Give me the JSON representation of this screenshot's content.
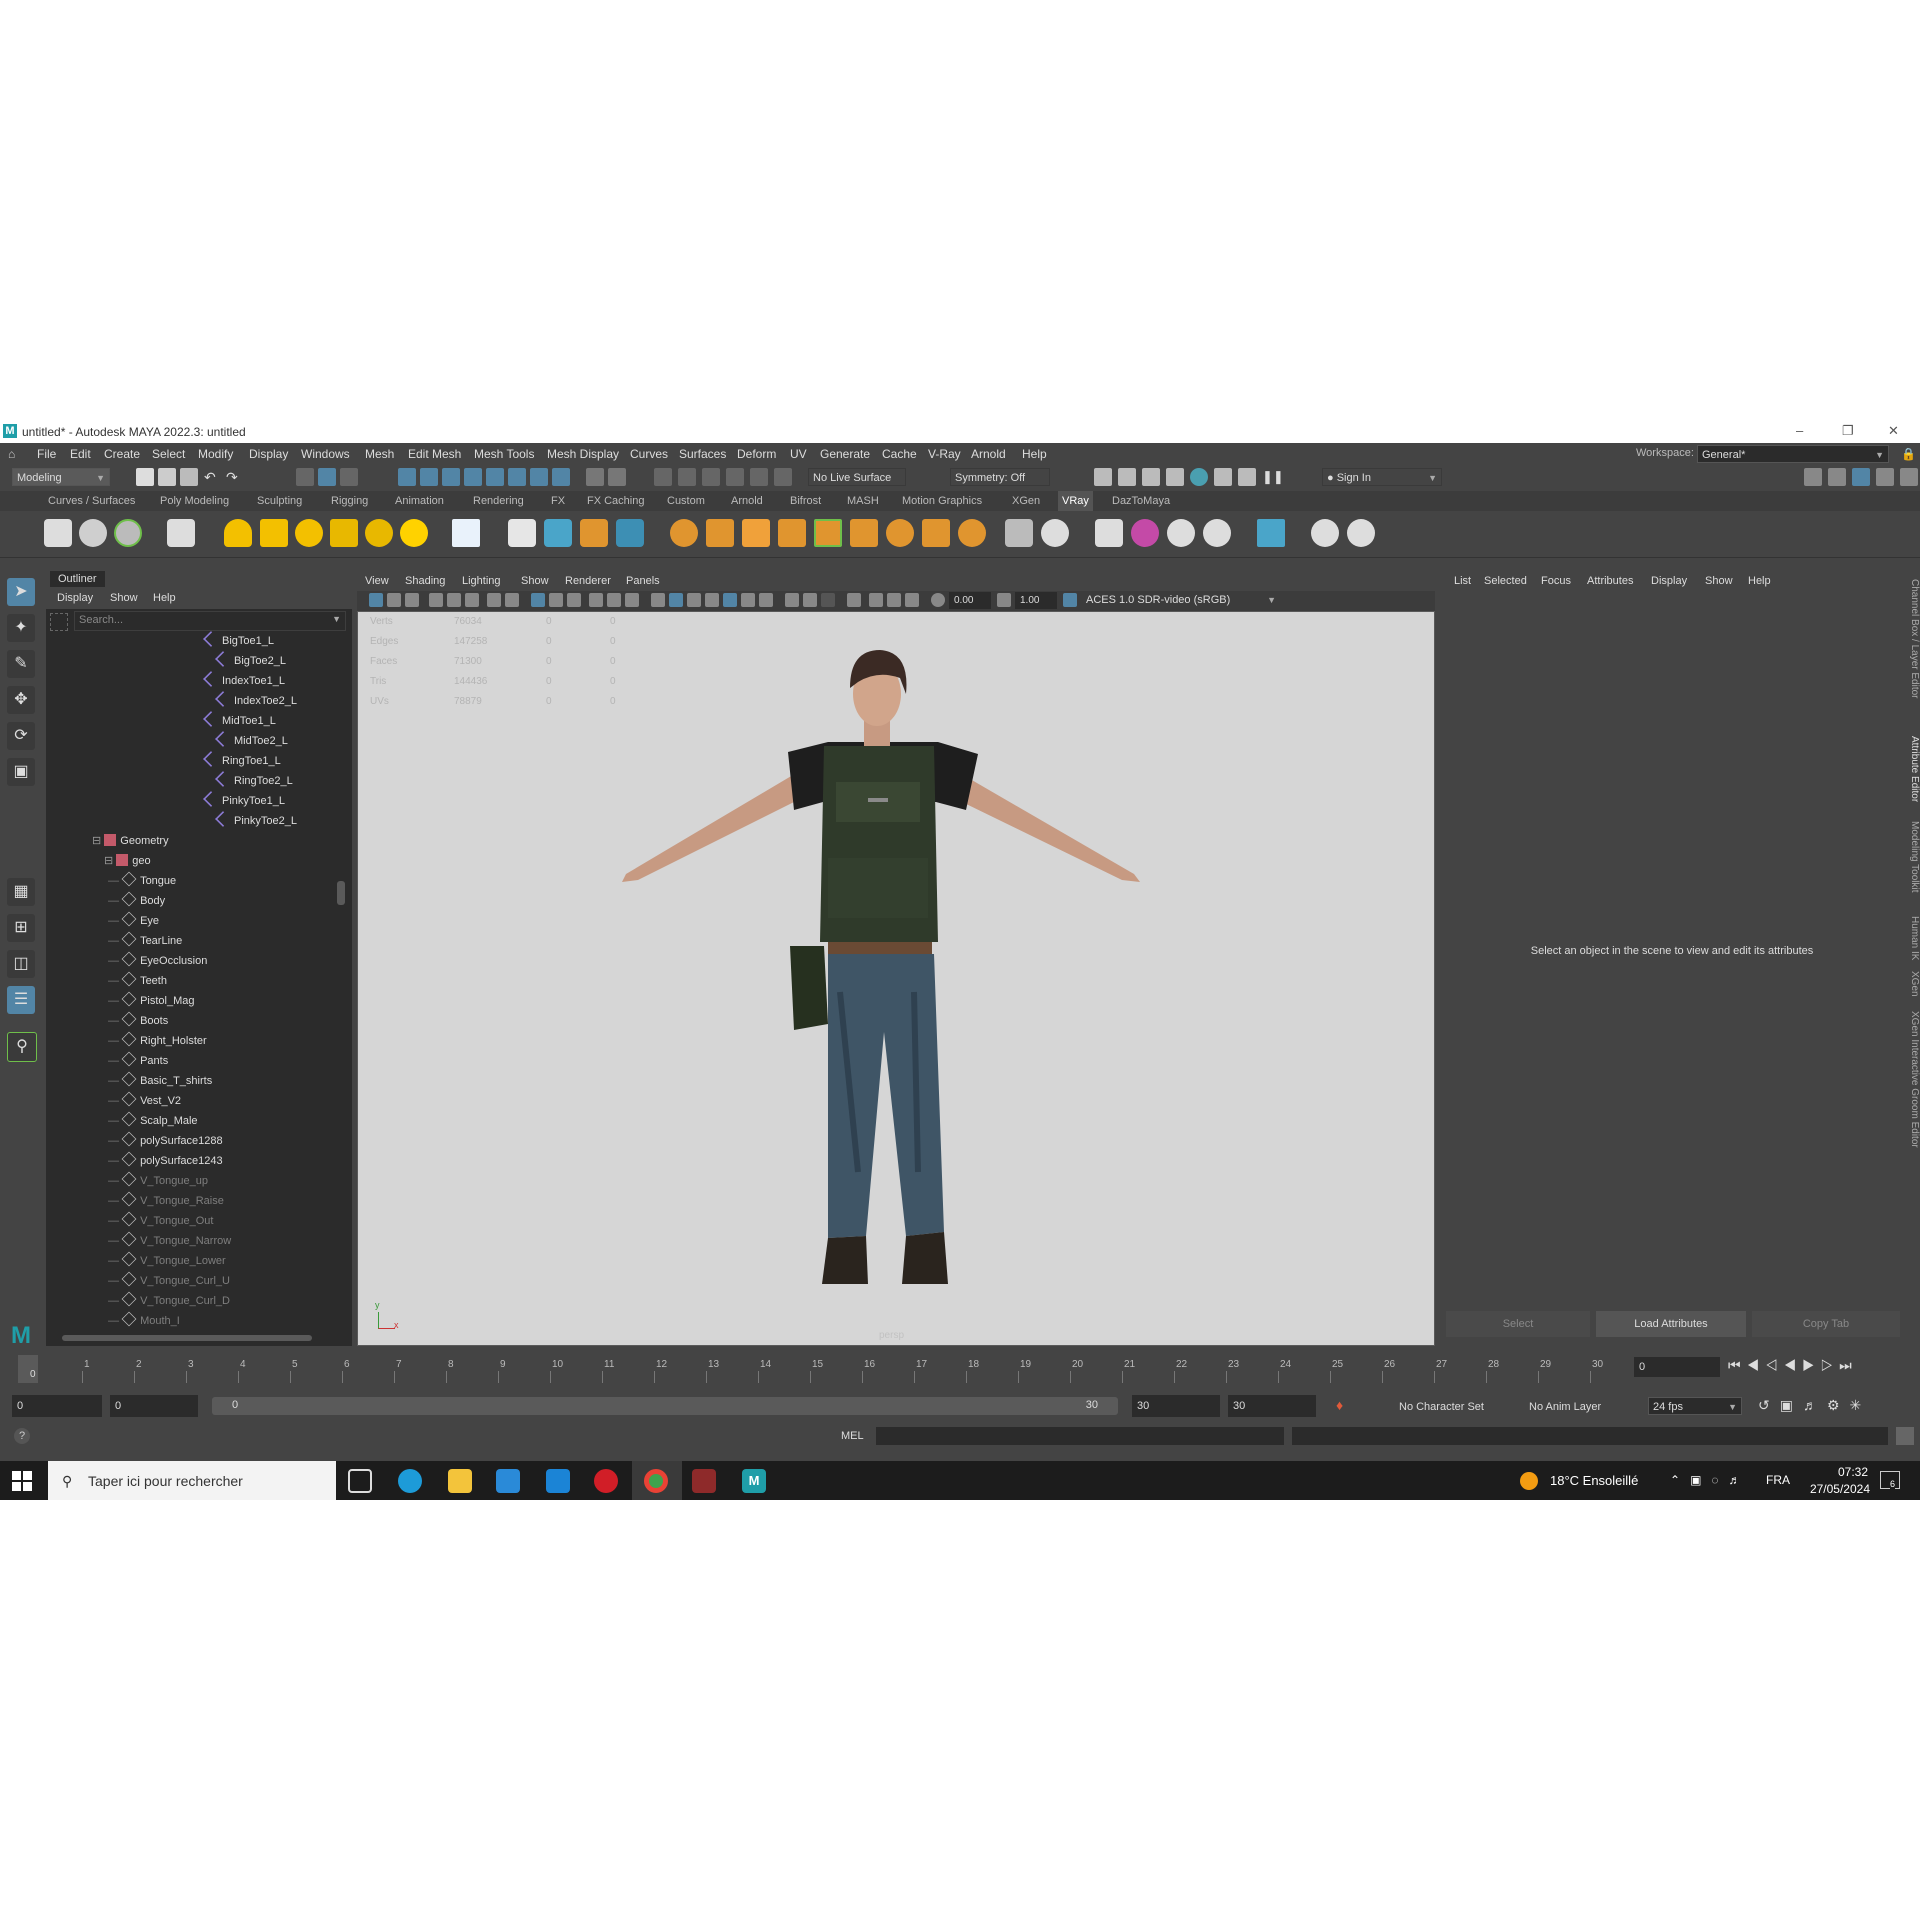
{
  "window": {
    "title": "untitled* - Autodesk MAYA 2022.3: untitled",
    "logo": "M"
  },
  "menubar": {
    "items": [
      "File",
      "Edit",
      "Create",
      "Select",
      "Modify",
      "Display",
      "Windows",
      "Mesh",
      "Edit Mesh",
      "Mesh Tools",
      "Mesh Display",
      "Curves",
      "Surfaces",
      "Deform",
      "UV",
      "Generate",
      "Cache",
      "V-Ray",
      "Arnold",
      "Help"
    ],
    "workspace_label": "Workspace:",
    "workspace_value": "General*"
  },
  "statusline": {
    "mode": "Modeling",
    "live_surface": "No Live Surface",
    "symmetry": "Symmetry: Off",
    "sign_in": "Sign In"
  },
  "shelf": {
    "tabs": [
      "Curves / Surfaces",
      "Poly Modeling",
      "Sculpting",
      "Rigging",
      "Animation",
      "Rendering",
      "FX",
      "FX Caching",
      "Custom",
      "Arnold",
      "Bifrost",
      "MASH",
      "Motion Graphics",
      "XGen",
      "VRay",
      "DazToMaya"
    ],
    "active_tab": "VRay"
  },
  "outliner": {
    "tab": "Outliner",
    "menu": [
      "Display",
      "Show",
      "Help"
    ],
    "search_placeholder": "Search...",
    "joints": [
      {
        "label": "BigToe1_L",
        "level": 0
      },
      {
        "label": "BigToe2_L",
        "level": 1
      },
      {
        "label": "IndexToe1_L",
        "level": 0
      },
      {
        "label": "IndexToe2_L",
        "level": 1
      },
      {
        "label": "MidToe1_L",
        "level": 0
      },
      {
        "label": "MidToe2_L",
        "level": 1
      },
      {
        "label": "RingToe1_L",
        "level": 0
      },
      {
        "label": "RingToe2_L",
        "level": 1
      },
      {
        "label": "PinkyToe1_L",
        "level": 0
      },
      {
        "label": "PinkyToe2_L",
        "level": 1
      }
    ],
    "geometry_group": "Geometry",
    "geo_group": "geo",
    "meshes": [
      {
        "label": "Tongue",
        "dim": false
      },
      {
        "label": "Body",
        "dim": false
      },
      {
        "label": "Eye",
        "dim": false
      },
      {
        "label": "TearLine",
        "dim": false
      },
      {
        "label": "EyeOcclusion",
        "dim": false
      },
      {
        "label": "Teeth",
        "dim": false
      },
      {
        "label": "Pistol_Mag",
        "dim": false
      },
      {
        "label": "Boots",
        "dim": false
      },
      {
        "label": "Right_Holster",
        "dim": false
      },
      {
        "label": "Pants",
        "dim": false
      },
      {
        "label": "Basic_T_shirts",
        "dim": false
      },
      {
        "label": "Vest_V2",
        "dim": false
      },
      {
        "label": "Scalp_Male",
        "dim": false
      },
      {
        "label": "polySurface1288",
        "dim": false
      },
      {
        "label": "polySurface1243",
        "dim": false
      },
      {
        "label": "V_Tongue_up",
        "dim": true
      },
      {
        "label": "V_Tongue_Raise",
        "dim": true
      },
      {
        "label": "V_Tongue_Out",
        "dim": true
      },
      {
        "label": "V_Tongue_Narrow",
        "dim": true
      },
      {
        "label": "V_Tongue_Lower",
        "dim": true
      },
      {
        "label": "V_Tongue_Curl_U",
        "dim": true
      },
      {
        "label": "V_Tongue_Curl_D",
        "dim": true
      },
      {
        "label": "Mouth_I",
        "dim": true
      }
    ]
  },
  "viewport": {
    "menu": [
      "View",
      "Shading",
      "Lighting",
      "Show",
      "Renderer",
      "Panels"
    ],
    "exposure": "0.00",
    "gamma": "1.00",
    "color_space": "ACES 1.0 SDR-video (sRGB)",
    "hud": [
      {
        "label": "Verts",
        "value": "76034",
        "a": "0",
        "b": "0"
      },
      {
        "label": "Edges",
        "value": "147258",
        "a": "0",
        "b": "0"
      },
      {
        "label": "Faces",
        "value": "71300",
        "a": "0",
        "b": "0"
      },
      {
        "label": "Tris",
        "value": "144436",
        "a": "0",
        "b": "0"
      },
      {
        "label": "UVs",
        "value": "78879",
        "a": "0",
        "b": "0"
      }
    ],
    "camera_label": "persp",
    "axis_x": "x",
    "axis_y": "y"
  },
  "attribute_editor": {
    "menu": [
      "List",
      "Selected",
      "Focus",
      "Attributes",
      "Display",
      "Show",
      "Help"
    ],
    "message": "Select an object in the scene to view and edit its attributes",
    "buttons": [
      "Select",
      "Load Attributes",
      "Copy Tab"
    ]
  },
  "side_tabs": [
    "Channel Box / Layer Editor",
    "Attribute Editor",
    "Modeling Toolkit",
    "Human IK",
    "XGen",
    "XGen Interactive Groom Editor"
  ],
  "timeline": {
    "ticks": [
      "0",
      "1",
      "2",
      "3",
      "4",
      "5",
      "6",
      "7",
      "8",
      "9",
      "10",
      "11",
      "12",
      "13",
      "14",
      "15",
      "16",
      "17",
      "18",
      "19",
      "20",
      "21",
      "22",
      "23",
      "24",
      "25",
      "26",
      "27",
      "28",
      "29",
      "30"
    ],
    "current_frame_marker": "0",
    "current_frame_field": "0"
  },
  "range": {
    "start": "0",
    "anim_start": "0",
    "slider_start": "0",
    "slider_end": "30",
    "anim_end": "30",
    "end": "30",
    "character_set": "No Character Set",
    "anim_layer": "No Anim Layer",
    "fps": "24 fps"
  },
  "commandline": {
    "label": "MEL"
  },
  "taskbar": {
    "search_placeholder": "Taper ici pour rechercher",
    "weather": "18°C  Ensoleillé",
    "language": "FRA",
    "time": "07:32",
    "date": "27/05/2024",
    "notif_count": "6"
  },
  "colors": {
    "maya_bg": "#444444",
    "panel_dark": "#2b2b2b",
    "viewport_bg": "#d6d6d6",
    "accent_blue": "#5285a6",
    "shelf_orange": "#e0952f",
    "taskbar": "#1c1c1c"
  }
}
